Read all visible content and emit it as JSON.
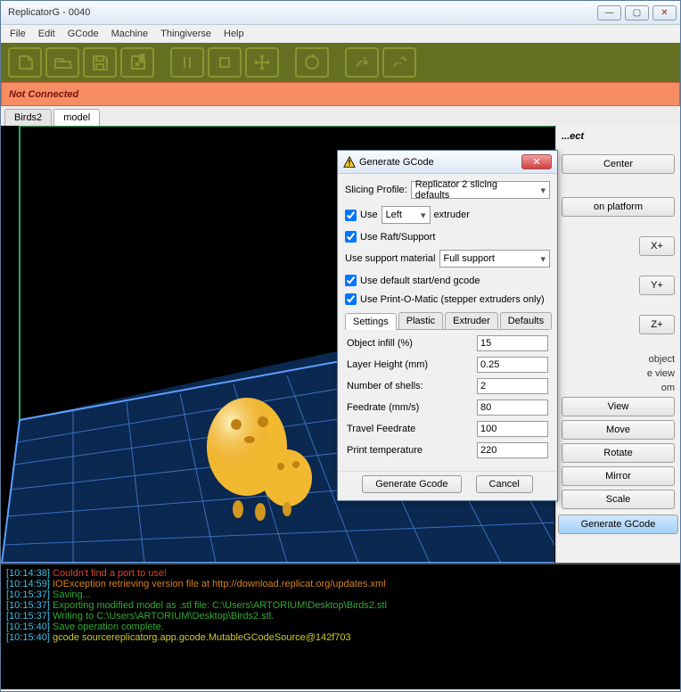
{
  "title": "ReplicatorG - 0040",
  "menu": [
    "File",
    "Edit",
    "GCode",
    "Machine",
    "Thingiverse",
    "Help"
  ],
  "status": "Not Connected",
  "mainTabs": {
    "a": "Birds2",
    "b": "model"
  },
  "side": {
    "objectTitle": "...ect",
    "center": "Center",
    "platform": "on platform",
    "xp": "X+",
    "yp": "Y+",
    "zp": "Z+",
    "hint1": "object",
    "hint2": "e view",
    "hint3": "om",
    "view": "View",
    "move": "Move",
    "rotate": "Rotate",
    "mirror": "Mirror",
    "scale": "Scale",
    "gen": "Generate GCode"
  },
  "dlg": {
    "title": "Generate GCode",
    "profileLabel": "Slicing Profile:",
    "profile": "Replicator 2 slicing defaults",
    "useLabel": "Use",
    "extruderSel": "Left",
    "extruderSuffix": "extruder",
    "raft": "Use Raft/Support",
    "supportLabel": "Use support material",
    "supportSel": "Full support",
    "defaultGcode": "Use default start/end gcode",
    "pomatic": "Use Print-O-Matic (stepper extruders only)",
    "tabs": [
      "Settings",
      "Plastic",
      "Extruder",
      "Defaults"
    ],
    "fields": {
      "infillL": "Object infill (%)",
      "infillV": "15",
      "layerL": "Layer Height (mm)",
      "layerV": "0.25",
      "shellsL": "Number of shells:",
      "shellsV": "2",
      "feedL": "Feedrate (mm/s)",
      "feedV": "80",
      "travelL": "Travel Feedrate",
      "travelV": "100",
      "tempL": "Print temperature",
      "tempV": "220"
    },
    "gen": "Generate Gcode",
    "cancel": "Cancel"
  },
  "console": [
    {
      "ts": "[10:14:38]",
      "cls": "red",
      "txt": " Couldn't find a port to use!"
    },
    {
      "ts": "[10:14:59]",
      "cls": "orange",
      "txt": " IOException retrieving version file at http://download.replicat.org/updates.xml"
    },
    {
      "ts": "[10:15:37]",
      "cls": "green",
      "txt": " Saving..."
    },
    {
      "ts": "[10:15:37]",
      "cls": "green",
      "txt": " Exporting modified model as .stl file: C:\\Users\\ARTORIUM\\Desktop\\Birds2.stl"
    },
    {
      "ts": "[10:15:37]",
      "cls": "green",
      "txt": " Writing to C:\\Users\\ARTORIUM\\Desktop\\Birds2.stl."
    },
    {
      "ts": "[10:15:40]",
      "cls": "green",
      "txt": " Save operation complete."
    },
    {
      "ts": "[10:15:40]",
      "cls": "yellow",
      "txt": " gcode sourcereplicatorg.app.gcode.MutableGCodeSource@142f703"
    }
  ]
}
